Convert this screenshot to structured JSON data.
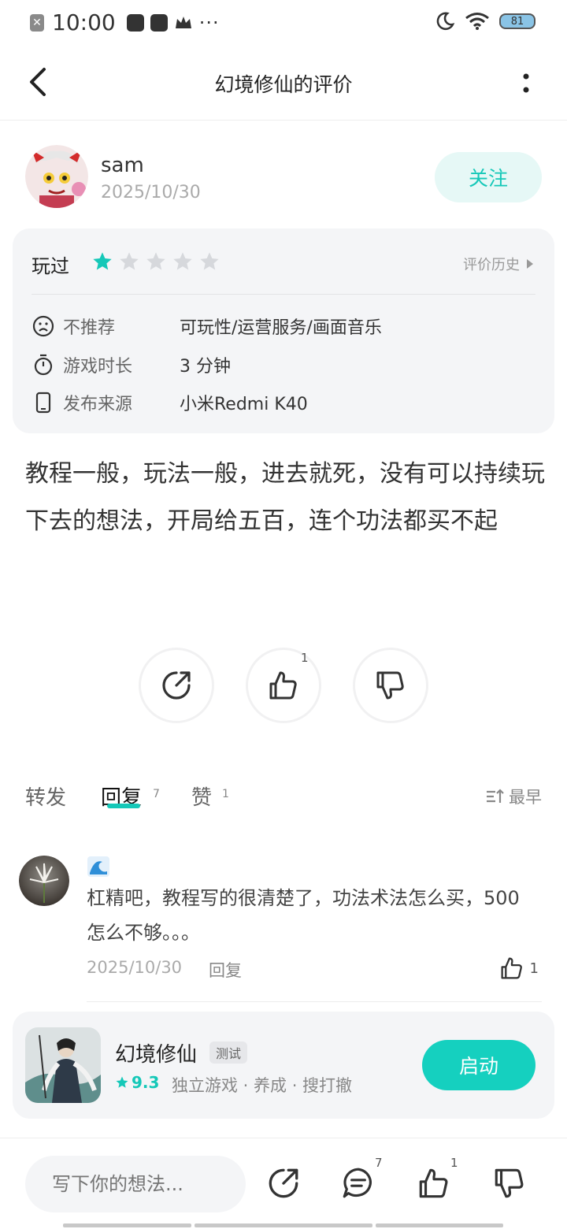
{
  "status_bar": {
    "time": "10:00",
    "battery": "81"
  },
  "header": {
    "title": "幻境修仙的评价"
  },
  "author": {
    "name": "sam",
    "date": "2025/10/30",
    "follow_label": "关注"
  },
  "rating": {
    "played_label": "玩过",
    "stars_total": 5,
    "stars_filled": 1,
    "history_label": "评价历史"
  },
  "info": [
    {
      "label": "不推荐",
      "value": "可玩性/运营服务/画面音乐",
      "icon": "sad-face-icon"
    },
    {
      "label": "游戏时长",
      "value": "3 分钟",
      "icon": "stopwatch-icon"
    },
    {
      "label": "发布来源",
      "value": "小米Redmi K40",
      "icon": "phone-icon"
    }
  ],
  "review": {
    "text": "教程一般，玩法一般，进去就死，没有可以持续玩下去的想法，开局给五百，连个功法都买不起"
  },
  "actions": {
    "like_count": "1"
  },
  "tabs": [
    {
      "label": "转发",
      "count": ""
    },
    {
      "label": "回复",
      "count": "7"
    },
    {
      "label": "赞",
      "count": "1"
    }
  ],
  "sort_label": "最早",
  "comment": {
    "text": "杠精吧，教程写的很清楚了，功法术法怎么买，500怎么不够。。。",
    "date": "2025/10/30",
    "reply_label": "回复",
    "like_count": "1"
  },
  "game": {
    "name": "幻境修仙",
    "tag": "测试",
    "score": "9.3",
    "genres": "独立游戏 · 养成 · 搜打撤",
    "launch_label": "启动"
  },
  "bottom_bar": {
    "input_placeholder": "写下你的想法...",
    "comment_count": "7",
    "like_count": "1"
  },
  "colors": {
    "accent": "#15c8b8",
    "card_bg": "#f4f5f7"
  }
}
